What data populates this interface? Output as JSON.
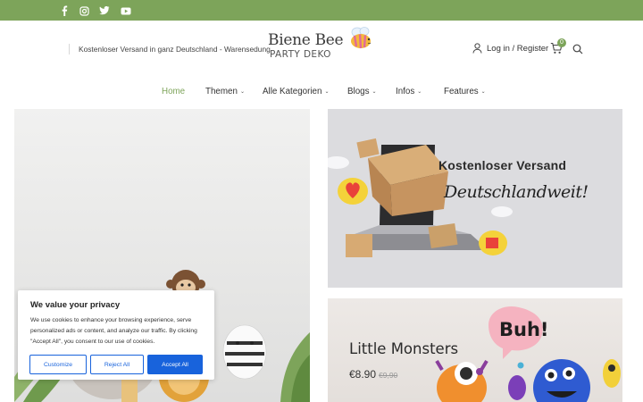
{
  "colors": {
    "brand_green": "#7da45a",
    "cookie_blue": "#1863dc"
  },
  "topbar": {
    "social_icons": [
      "facebook-icon",
      "instagram-icon",
      "twitter-icon",
      "youtube-icon"
    ]
  },
  "header": {
    "shipping_note": "Kostenloser Versand in ganz Deutschland - Warensedung",
    "logo_line1": "Biene Bee",
    "logo_line2": "PARTY DEKO",
    "login_label": "Log in / Register",
    "cart_count": "0"
  },
  "nav": {
    "items": [
      {
        "label": "Home",
        "active": true
      },
      {
        "label": "Themen",
        "dropdown": true
      },
      {
        "label": "Alle Kategorien",
        "dropdown": true
      },
      {
        "label": "Blogs",
        "dropdown": true
      },
      {
        "label": "Infos",
        "dropdown": true
      },
      {
        "label": "Features",
        "dropdown": true
      }
    ]
  },
  "promo_shipping": {
    "title": "Kostenloser Versand",
    "script": "Deutschlandweit!"
  },
  "promo_monsters": {
    "title": "Little Monsters",
    "price": "€8.90",
    "old_price": "€9,90",
    "bubble_text": "Buh!"
  },
  "cookie_banner": {
    "title": "We value your privacy",
    "text": "We use cookies to enhance your browsing experience, serve personalized ads or content, and analyze our traffic. By clicking \"Accept All\", you consent to our use of cookies.",
    "customize_label": "Customize",
    "reject_label": "Reject All",
    "accept_label": "Accept All"
  }
}
